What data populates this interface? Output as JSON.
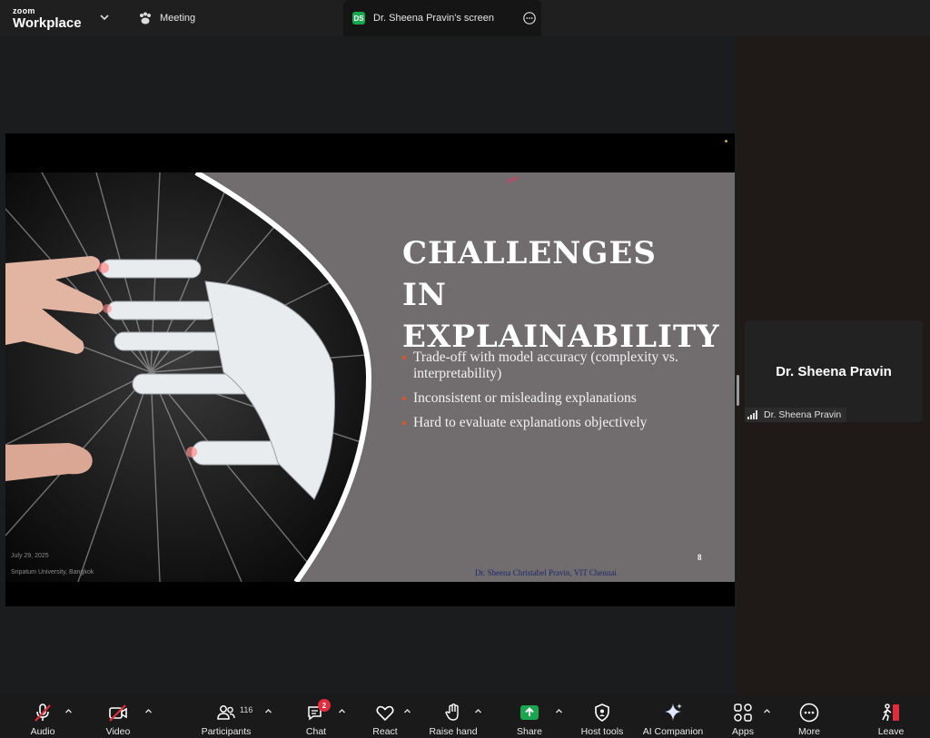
{
  "app": {
    "brand_top": "zoom",
    "brand_bottom": "Workplace"
  },
  "tabs": {
    "meeting": "Meeting",
    "screen_badge": "DS",
    "screen_title": "Dr. Sheena Pravin's screen"
  },
  "slide": {
    "title_line1": "CHALLENGES IN",
    "title_line2": "EXPLAINABILITY",
    "bullets": [
      "Trade-off with model accuracy (complexity vs. interpretability)",
      "Inconsistent or misleading explanations",
      "Hard to evaluate explanations objectively"
    ],
    "page_number": "8",
    "author": "Dr. Sheena Christabel Pravin, VIT Chennai",
    "date": "July 29, 2025",
    "university": "Sripatum University, Bangkok"
  },
  "participant_tile": {
    "display_name": "Dr. Sheena Pravin",
    "name_label": "Dr. Sheena Pravin"
  },
  "toolbar": {
    "audio": "Audio",
    "video": "Video",
    "participants": "Participants",
    "participants_count": "116",
    "chat": "Chat",
    "chat_badge": "2",
    "react": "React",
    "raise_hand": "Raise hand",
    "share": "Share",
    "host_tools": "Host tools",
    "ai_companion": "AI Companion",
    "apps": "Apps",
    "more": "More",
    "leave": "Leave"
  },
  "colors": {
    "share_green": "#1aa54f",
    "mute_red": "#e22c3c",
    "leave_red": "#e22c3c",
    "slide_bg": "#716c6e",
    "bullet_orange": "#d2552b"
  },
  "icons": {
    "topbar": [
      "chevron-down-icon",
      "paw-icon",
      "more-options-icon"
    ],
    "toolbar": [
      "microphone-muted-icon",
      "video-camera-muted-icon",
      "participants-icon",
      "chat-bubble-icon",
      "heart-icon",
      "hand-icon",
      "share-arrow-icon",
      "shield-icon",
      "sparkle-icon",
      "apps-grid-icon",
      "more-dots-icon",
      "leave-door-icon",
      "caret-up-icon"
    ],
    "tile": [
      "signal-bars-icon"
    ]
  }
}
